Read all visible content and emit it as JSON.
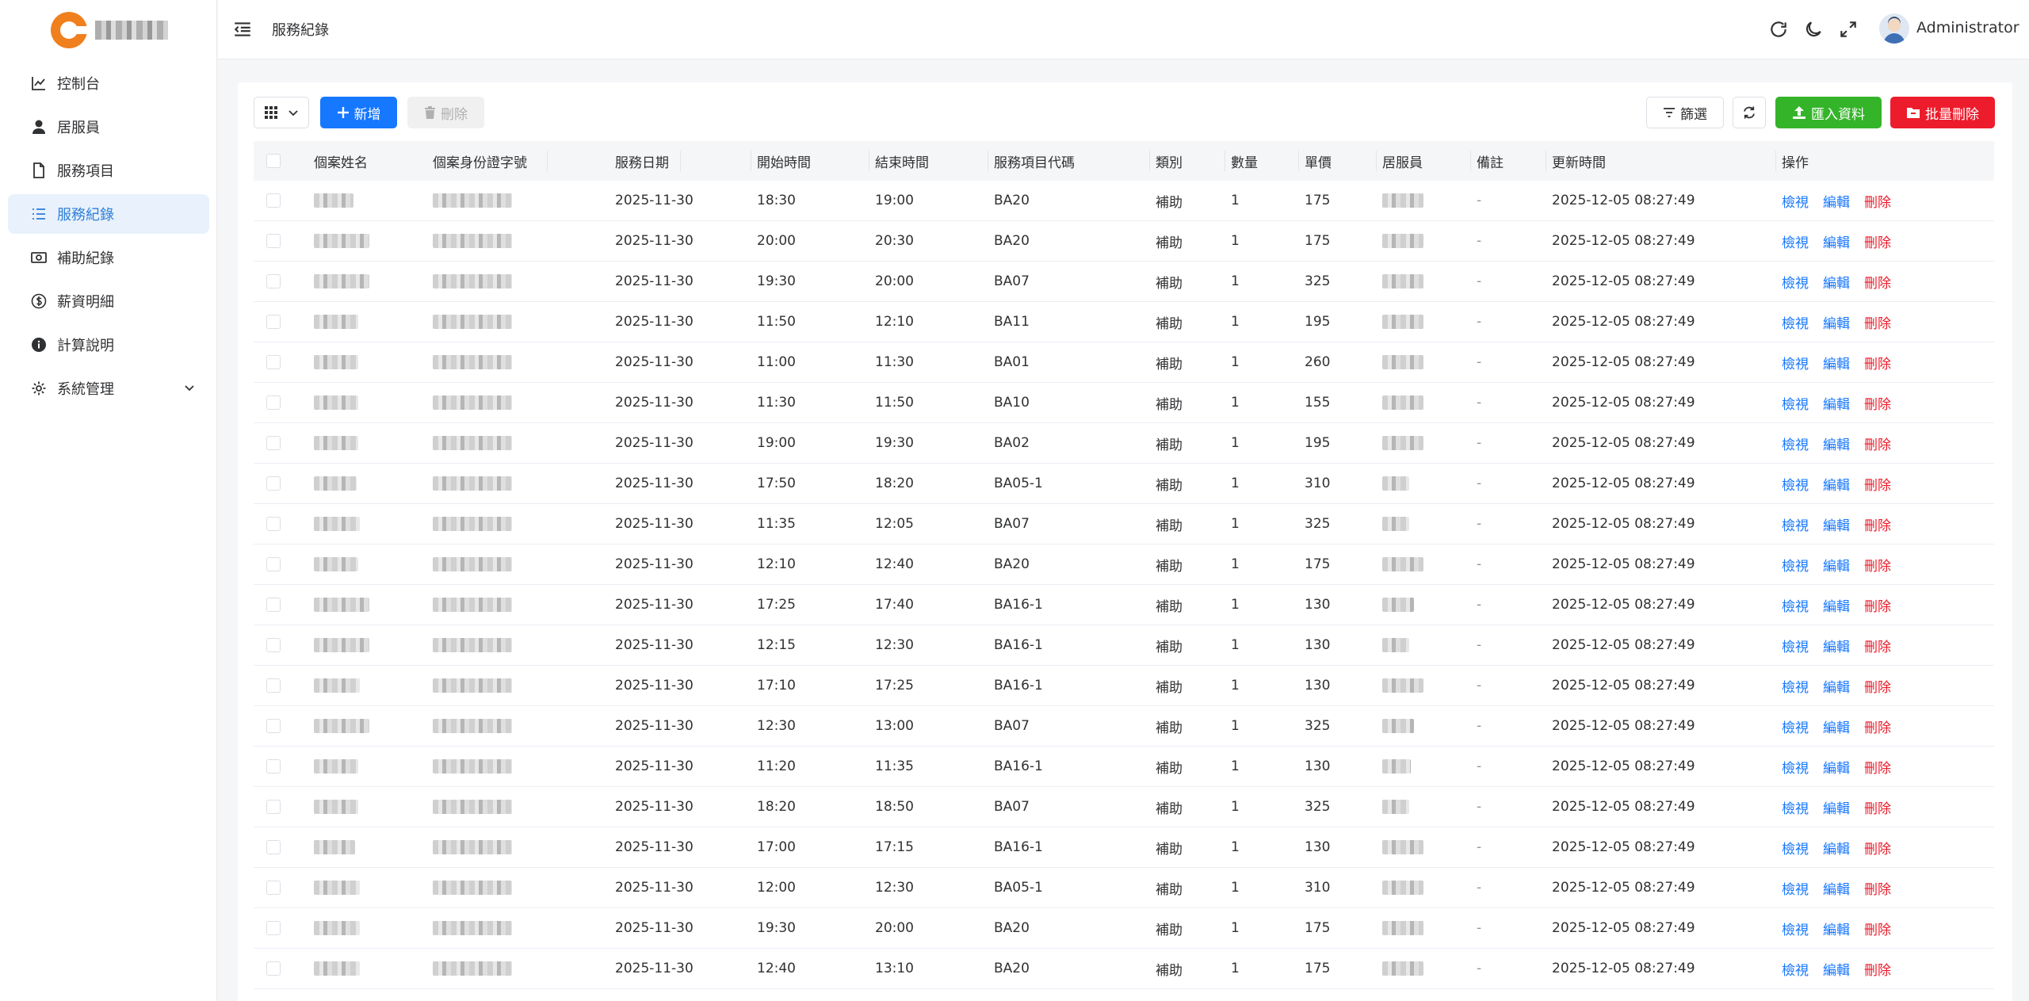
{
  "header": {
    "page_title": "服務紀錄",
    "user_name": "Administrator"
  },
  "sidebar": {
    "items": [
      {
        "label": "控制台",
        "icon": "chart-line-icon"
      },
      {
        "label": "居服員",
        "icon": "user-icon"
      },
      {
        "label": "服務項目",
        "icon": "document-icon"
      },
      {
        "label": "服務紀錄",
        "icon": "list-icon",
        "active": true
      },
      {
        "label": "補助紀錄",
        "icon": "money-icon"
      },
      {
        "label": "薪資明細",
        "icon": "dollar-circle-icon"
      },
      {
        "label": "計算說明",
        "icon": "info-icon"
      },
      {
        "label": "系統管理",
        "icon": "gear-icon"
      }
    ]
  },
  "toolbar": {
    "add_label": "新增",
    "delete_label": "刪除",
    "filter_label": "篩選",
    "import_label": "匯入資料",
    "bulk_delete_label": "批量刪除"
  },
  "table": {
    "headers": [
      "個案姓名",
      "個案身份證字號",
      "服務日期",
      "開始時間",
      "結束時間",
      "服務項目代碼",
      "類別",
      "數量",
      "單價",
      "居服員",
      "備註",
      "更新時間",
      "操作"
    ],
    "actions": {
      "view": "檢視",
      "edit": "編輯",
      "delete": "刪除"
    },
    "rows": [
      {
        "date": "2025-11-30",
        "start": "18:30",
        "end": "19:00",
        "code": "BA20",
        "category": "補助",
        "qty": "1",
        "price": "175",
        "note": "-",
        "updated": "2025-12-05 08:27:49"
      },
      {
        "date": "2025-11-30",
        "start": "20:00",
        "end": "20:30",
        "code": "BA20",
        "category": "補助",
        "qty": "1",
        "price": "175",
        "note": "-",
        "updated": "2025-12-05 08:27:49"
      },
      {
        "date": "2025-11-30",
        "start": "19:30",
        "end": "20:00",
        "code": "BA07",
        "category": "補助",
        "qty": "1",
        "price": "325",
        "note": "-",
        "updated": "2025-12-05 08:27:49"
      },
      {
        "date": "2025-11-30",
        "start": "11:50",
        "end": "12:10",
        "code": "BA11",
        "category": "補助",
        "qty": "1",
        "price": "195",
        "note": "-",
        "updated": "2025-12-05 08:27:49"
      },
      {
        "date": "2025-11-30",
        "start": "11:00",
        "end": "11:30",
        "code": "BA01",
        "category": "補助",
        "qty": "1",
        "price": "260",
        "note": "-",
        "updated": "2025-12-05 08:27:49"
      },
      {
        "date": "2025-11-30",
        "start": "11:30",
        "end": "11:50",
        "code": "BA10",
        "category": "補助",
        "qty": "1",
        "price": "155",
        "note": "-",
        "updated": "2025-12-05 08:27:49"
      },
      {
        "date": "2025-11-30",
        "start": "19:00",
        "end": "19:30",
        "code": "BA02",
        "category": "補助",
        "qty": "1",
        "price": "195",
        "note": "-",
        "updated": "2025-12-05 08:27:49"
      },
      {
        "date": "2025-11-30",
        "start": "17:50",
        "end": "18:20",
        "code": "BA05-1",
        "category": "補助",
        "qty": "1",
        "price": "310",
        "note": "-",
        "updated": "2025-12-05 08:27:49"
      },
      {
        "date": "2025-11-30",
        "start": "11:35",
        "end": "12:05",
        "code": "BA07",
        "category": "補助",
        "qty": "1",
        "price": "325",
        "note": "-",
        "updated": "2025-12-05 08:27:49"
      },
      {
        "date": "2025-11-30",
        "start": "12:10",
        "end": "12:40",
        "code": "BA20",
        "category": "補助",
        "qty": "1",
        "price": "175",
        "note": "-",
        "updated": "2025-12-05 08:27:49"
      },
      {
        "date": "2025-11-30",
        "start": "17:25",
        "end": "17:40",
        "code": "BA16-1",
        "category": "補助",
        "qty": "1",
        "price": "130",
        "note": "-",
        "updated": "2025-12-05 08:27:49"
      },
      {
        "date": "2025-11-30",
        "start": "12:15",
        "end": "12:30",
        "code": "BA16-1",
        "category": "補助",
        "qty": "1",
        "price": "130",
        "note": "-",
        "updated": "2025-12-05 08:27:49"
      },
      {
        "date": "2025-11-30",
        "start": "17:10",
        "end": "17:25",
        "code": "BA16-1",
        "category": "補助",
        "qty": "1",
        "price": "130",
        "note": "-",
        "updated": "2025-12-05 08:27:49"
      },
      {
        "date": "2025-11-30",
        "start": "12:30",
        "end": "13:00",
        "code": "BA07",
        "category": "補助",
        "qty": "1",
        "price": "325",
        "note": "-",
        "updated": "2025-12-05 08:27:49"
      },
      {
        "date": "2025-11-30",
        "start": "11:20",
        "end": "11:35",
        "code": "BA16-1",
        "category": "補助",
        "qty": "1",
        "price": "130",
        "note": "-",
        "updated": "2025-12-05 08:27:49"
      },
      {
        "date": "2025-11-30",
        "start": "18:20",
        "end": "18:50",
        "code": "BA07",
        "category": "補助",
        "qty": "1",
        "price": "325",
        "note": "-",
        "updated": "2025-12-05 08:27:49"
      },
      {
        "date": "2025-11-30",
        "start": "17:00",
        "end": "17:15",
        "code": "BA16-1",
        "category": "補助",
        "qty": "1",
        "price": "130",
        "note": "-",
        "updated": "2025-12-05 08:27:49"
      },
      {
        "date": "2025-11-30",
        "start": "12:00",
        "end": "12:30",
        "code": "BA05-1",
        "category": "補助",
        "qty": "1",
        "price": "310",
        "note": "-",
        "updated": "2025-12-05 08:27:49"
      },
      {
        "date": "2025-11-30",
        "start": "19:30",
        "end": "20:00",
        "code": "BA20",
        "category": "補助",
        "qty": "1",
        "price": "175",
        "note": "-",
        "updated": "2025-12-05 08:27:49"
      },
      {
        "date": "2025-11-30",
        "start": "12:40",
        "end": "13:10",
        "code": "BA20",
        "category": "補助",
        "qty": "1",
        "price": "175",
        "note": "-",
        "updated": "2025-12-05 08:27:49"
      }
    ]
  },
  "colors": {
    "primary": "#1677ff",
    "success": "#34b429",
    "danger": "#ec1c2c",
    "active_menu_bg": "#e8f1fc",
    "brand_orange": "#f07f1e"
  }
}
